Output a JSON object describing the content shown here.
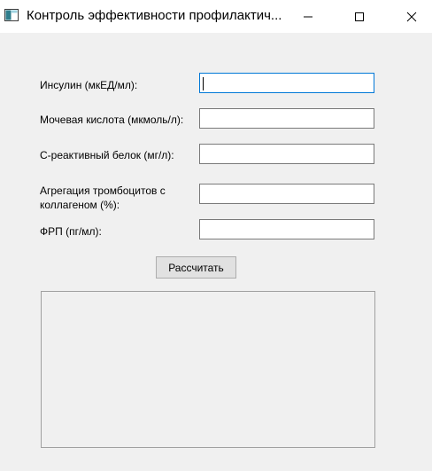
{
  "window": {
    "title": "Контроль эффективности профилактич...",
    "icon": "app-window-icon",
    "controls": {
      "minimize": "minimize-icon",
      "maximize": "maximize-icon",
      "close": "close-icon"
    }
  },
  "form": {
    "insulin": {
      "label": "Инсулин (мкЕД/мл):",
      "value": ""
    },
    "uric_acid": {
      "label": "Мочевая кислота (мкмоль/л):",
      "value": ""
    },
    "crp": {
      "label": "С-реактивный белок (мг/л):",
      "value": ""
    },
    "platelet_aggregation": {
      "label": "Агрегация тромбоцитов с коллагеном (%):",
      "value": ""
    },
    "frp": {
      "label": "ФРП (пг/мл):",
      "value": ""
    }
  },
  "actions": {
    "calculate_label": "Рассчитать"
  },
  "output": {
    "text": ""
  },
  "colors": {
    "background": "#f0f0f0",
    "titlebar": "#ffffff",
    "focus_border": "#0078d7",
    "button_bg": "#e1e1e1"
  }
}
